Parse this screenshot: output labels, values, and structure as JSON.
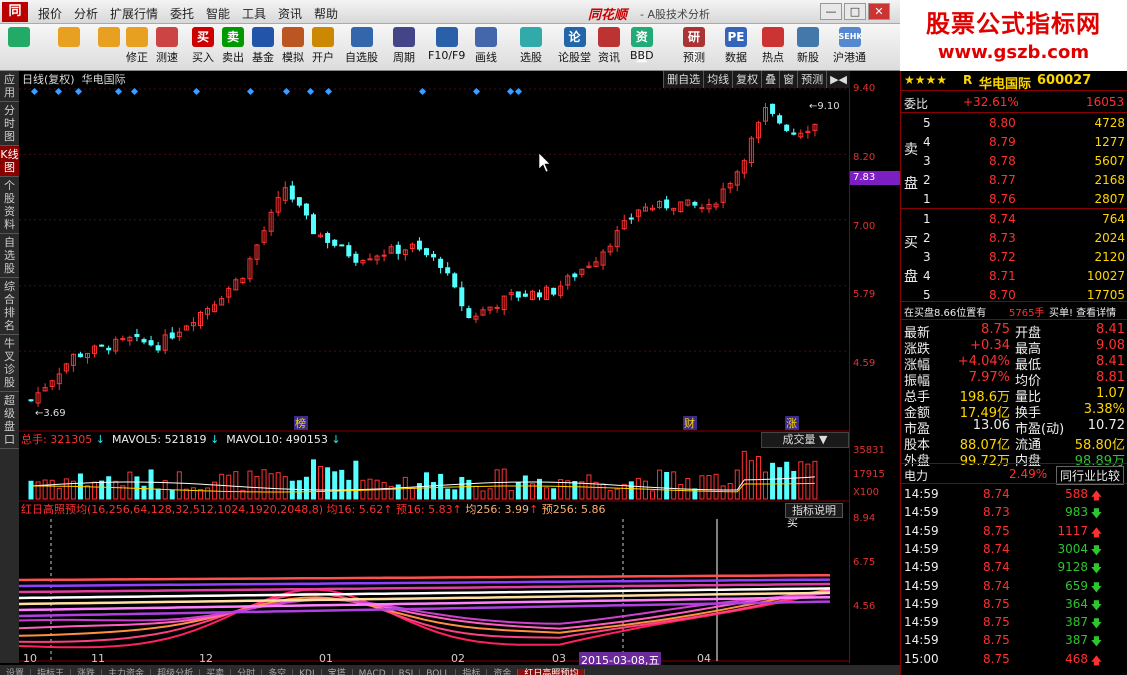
{
  "menu": {
    "logo": "同",
    "items": [
      "报价",
      "分析",
      "扩展行情",
      "委托",
      "智能",
      "工具",
      "资讯",
      "帮助"
    ],
    "brand": "同花顺",
    "subtitle": "- A股技术分析",
    "winbtns": [
      "—",
      "□",
      "✕"
    ]
  },
  "toolbar": [
    {
      "label": "",
      "icon": "grid"
    },
    {
      "label": "",
      "icon": "arrow-left"
    },
    {
      "label": "",
      "icon": "updown"
    },
    {
      "label": "修正",
      "icon": "fix"
    },
    {
      "label": "测速",
      "icon": "clock"
    },
    {
      "label": "买入",
      "icon": "buy",
      "glyph": "买"
    },
    {
      "label": "卖出",
      "icon": "sell",
      "glyph": "卖"
    },
    {
      "label": "基金",
      "icon": "fund"
    },
    {
      "label": "模拟",
      "icon": "hammer"
    },
    {
      "label": "开户",
      "icon": "lock"
    },
    {
      "label": "自选股",
      "icon": "star"
    },
    {
      "label": "周期",
      "icon": "cycle"
    },
    {
      "label": "F10/F9",
      "icon": "f10"
    },
    {
      "label": "画线",
      "icon": "pen"
    },
    {
      "label": "选股",
      "icon": "select"
    },
    {
      "label": "论股堂",
      "icon": "lun",
      "glyph": "论"
    },
    {
      "label": "资讯",
      "icon": "news"
    },
    {
      "label": "BBD",
      "icon": "bbd",
      "glyph": "资金"
    },
    {
      "label": "预测",
      "icon": "yan",
      "glyph": "研报"
    },
    {
      "label": "数据",
      "icon": "pe",
      "glyph": "PE"
    },
    {
      "label": "热点",
      "icon": "hot"
    },
    {
      "label": "新股",
      "icon": "new"
    },
    {
      "label": "沪港通",
      "icon": "sehk",
      "glyph": "SEHK"
    }
  ],
  "watermark": {
    "line1": "股票公式指标网",
    "line2": "www.gszb.com"
  },
  "lefttabs": [
    "应用",
    "分时图",
    "K线图",
    "个股资料",
    "自选股",
    "综合排名",
    "牛叉诊股",
    "超级盘口"
  ],
  "kline": {
    "title": "日线(复权)",
    "name": "华电国际",
    "buttons": [
      "删自选",
      "均线",
      "复权",
      "叠",
      "窗",
      "预测",
      "▶◀"
    ],
    "high_label": "9.10",
    "low_label": "3.69",
    "markers": [
      "榜",
      "财",
      "涨"
    ]
  },
  "price_axis": {
    "labels": [
      "9.40",
      "8.20",
      "7.00",
      "5.79",
      "4.59"
    ],
    "current": "7.83"
  },
  "volume": {
    "label": "总手:",
    "value": "321305",
    "ma5": "MAVOL5: 521819",
    "ma10": "MAVOL10: 490153",
    "button": "成交量 ▼",
    "axis": [
      "35831",
      "17915",
      "X100"
    ]
  },
  "indicator": {
    "name": "红日高照预均(16,256,64,128,32,512,1024,1920,2048,8)",
    "v1": "均16: 5.62",
    "v2": "预16: 5.83",
    "v3": "均256: 3.99",
    "v4": "预256: 5.86",
    "button": "指标说明",
    "axis": [
      "8.94",
      "6.75",
      "4.56"
    ],
    "buy_mark": "买"
  },
  "dates": [
    {
      "t": "10"
    },
    {
      "t": "11"
    },
    {
      "t": "12"
    },
    {
      "t": "01"
    },
    {
      "t": "02"
    },
    {
      "t": "03"
    },
    {
      "t": "2015-03-08,五",
      "hl": true
    },
    {
      "t": "04"
    }
  ],
  "bottomtabs": [
    "设置",
    "指标王",
    "涨跌",
    "主力资金",
    "超级分析",
    "买卖",
    "分时",
    "多空",
    "KDJ",
    "宝塔",
    "MACD",
    "RSI",
    "BOLL",
    "指标",
    "资金",
    "红日高照预均"
  ],
  "quote": {
    "stars": "★★★★",
    "r": "R",
    "name": "华电国际",
    "code": "600027",
    "webi_label": "委比",
    "webi": "+32.61%",
    "webc": "16053",
    "sell": [
      {
        "n": "5",
        "p": "8.80",
        "v": "4728"
      },
      {
        "n": "4",
        "p": "8.79",
        "v": "1277"
      },
      {
        "n": "3",
        "p": "8.78",
        "v": "5607"
      },
      {
        "n": "2",
        "p": "8.77",
        "v": "2168"
      },
      {
        "n": "1",
        "p": "8.76",
        "v": "2807"
      }
    ],
    "buy": [
      {
        "n": "1",
        "p": "8.74",
        "v": "764"
      },
      {
        "n": "2",
        "p": "8.73",
        "v": "2024"
      },
      {
        "n": "3",
        "p": "8.72",
        "v": "2120"
      },
      {
        "n": "4",
        "p": "8.71",
        "v": "10027"
      },
      {
        "n": "5",
        "p": "8.70",
        "v": "17705"
      }
    ],
    "sell_label": "卖盘",
    "buy_label": "买盘",
    "notice": "在买盘8.66位置有",
    "notice2": "5765手",
    "notice3": "买单! 查看详情",
    "stats": [
      {
        "l1": "最新",
        "v1": "8.75",
        "l2": "开盘",
        "v2": "8.41"
      },
      {
        "l1": "涨跌",
        "v1": "+0.34",
        "l2": "最高",
        "v2": "9.08"
      },
      {
        "l1": "涨幅",
        "v1": "+4.04%",
        "l2": "最低",
        "v2": "8.41"
      },
      {
        "l1": "振幅",
        "v1": "7.97%",
        "l2": "均价",
        "v2": "8.81"
      },
      {
        "l1": "总手",
        "v1": "198.6万",
        "l2": "量比",
        "v2": "1.07"
      },
      {
        "l1": "金额",
        "v1": "17.49亿",
        "l2": "换手",
        "v2": "3.38%"
      },
      {
        "l1": "市盈",
        "v1": "13.06",
        "l2": "市盈(动)",
        "v2": "10.72"
      },
      {
        "l1": "股本",
        "v1": "88.07亿",
        "l2": "流通",
        "v2": "58.80亿"
      },
      {
        "l1": "外盘",
        "v1": "99.72万",
        "l2": "内盘",
        "v2": "98.89万"
      }
    ],
    "industry": "电力",
    "industry_pct": "2.49%",
    "industry_btn": "同行业比较",
    "ticks": [
      {
        "t": "14:59",
        "p": "8.74",
        "v": "588",
        "d": "up"
      },
      {
        "t": "14:59",
        "p": "8.73",
        "v": "983",
        "d": "dn"
      },
      {
        "t": "14:59",
        "p": "8.75",
        "v": "1117",
        "d": "up"
      },
      {
        "t": "14:59",
        "p": "8.74",
        "v": "3004",
        "d": "dn"
      },
      {
        "t": "14:59",
        "p": "8.74",
        "v": "9128",
        "d": "dn"
      },
      {
        "t": "14:59",
        "p": "8.74",
        "v": "659",
        "d": "dn"
      },
      {
        "t": "14:59",
        "p": "8.75",
        "v": "364",
        "d": "dn"
      },
      {
        "t": "14:59",
        "p": "8.75",
        "v": "387",
        "d": "dn"
      },
      {
        "t": "14:59",
        "p": "8.75",
        "v": "387",
        "d": "dn"
      },
      {
        "t": "15:00",
        "p": "8.75",
        "v": "468",
        "d": "up"
      }
    ]
  }
}
